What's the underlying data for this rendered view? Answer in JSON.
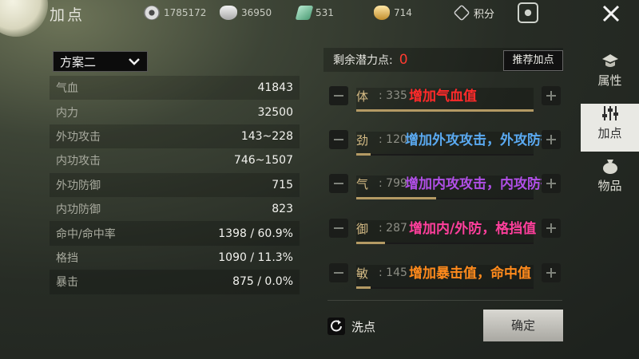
{
  "header": {
    "title": "加点",
    "resources": [
      {
        "icon": "film-reel-icon",
        "value": "1785172"
      },
      {
        "icon": "silver-ingot-icon",
        "value": "36950"
      },
      {
        "icon": "jade-icon",
        "value": "531"
      },
      {
        "icon": "gold-ingot-icon",
        "value": "714"
      }
    ],
    "score_label": "积分"
  },
  "tabs": [
    {
      "label": "属性",
      "icon": "hat-icon",
      "active": false
    },
    {
      "label": "加点",
      "icon": "sliders-icon",
      "active": true
    },
    {
      "label": "物品",
      "icon": "bag-icon",
      "active": false
    }
  ],
  "scheme": {
    "selected": "方案二"
  },
  "stats": [
    {
      "name": "气血",
      "value": "41843"
    },
    {
      "name": "内力",
      "value": "32500"
    },
    {
      "name": "外功攻击",
      "value": "143~228"
    },
    {
      "name": "内功攻击",
      "value": "746~1507"
    },
    {
      "name": "外功防御",
      "value": "715"
    },
    {
      "name": "内功防御",
      "value": "823"
    },
    {
      "name": "命中/命中率",
      "value": "1398 / 60.9%"
    },
    {
      "name": "格挡",
      "value": "1090 / 11.3%"
    },
    {
      "name": "暴击",
      "value": "875 / 0.0%"
    }
  ],
  "potential": {
    "label": "剩余潜力点:",
    "value": "0",
    "recommend_label": "推荐加点"
  },
  "attributes": [
    {
      "name": "体",
      "value": ": 335",
      "desc": "增加气血值",
      "desc_color": "#ff2a2a",
      "fill_fraction": 1.0
    },
    {
      "name": "劲",
      "value": ": 120",
      "desc": "增加外攻攻击，外攻防御",
      "desc_color": "#5aa9f0",
      "fill_fraction": 0.08
    },
    {
      "name": "气",
      "value": ": 799",
      "desc": "增加内攻攻击，内攻防御",
      "desc_color": "#b14fe8",
      "fill_fraction": 0.45
    },
    {
      "name": "御",
      "value": ": 287",
      "desc": "增加内/外防，格挡值",
      "desc_color": "#ff3f9c",
      "fill_fraction": 0.16
    },
    {
      "name": "敏",
      "value": ": 145",
      "desc": "增加暴击值，命中值",
      "desc_color": "#ff8a1c",
      "fill_fraction": 0.08
    }
  ],
  "footer": {
    "reset_label": "洗点",
    "confirm_label": "确定"
  }
}
